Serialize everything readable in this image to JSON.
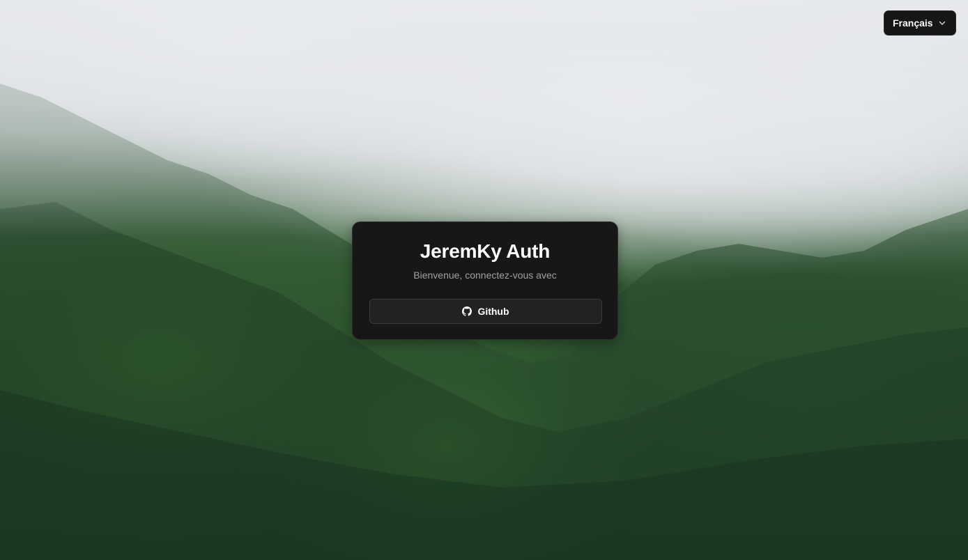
{
  "language_select": {
    "selected": "Français",
    "icon": "chevron-down-icon"
  },
  "auth_card": {
    "title": "JeremKy Auth",
    "subtitle": "Bienvenue, connectez-vous avec",
    "providers": [
      {
        "label": "Github",
        "icon": "github-icon"
      }
    ]
  },
  "colors": {
    "card_background": "#171717",
    "button_background": "#222222",
    "subtitle_text": "#a1a1a1",
    "fog": "#dde0e4",
    "forest": "#2f5532"
  }
}
